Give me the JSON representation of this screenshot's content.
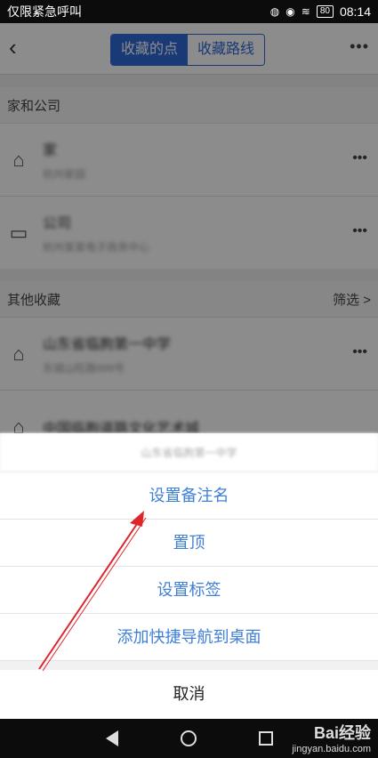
{
  "status_bar": {
    "carrier": "仅限紧急呼叫",
    "battery": "80",
    "time": "08:14"
  },
  "header": {
    "tabs": [
      {
        "label": "收藏的点",
        "active": true
      },
      {
        "label": "收藏路线",
        "active": false
      }
    ],
    "more": "•••"
  },
  "sections": {
    "home_company": {
      "title": "家和公司"
    },
    "others": {
      "title": "其他收藏",
      "filter": "筛选 >"
    }
  },
  "rows": [
    {
      "title": "家",
      "subtitle": "杭州家园"
    },
    {
      "title": "公司",
      "subtitle": "杭州某某电子商务中心"
    },
    {
      "title": "山东省临朐第一中学",
      "subtitle": "东城山旺路999号"
    },
    {
      "title": "中国临朐道路文化艺术城",
      "subtitle": ""
    }
  ],
  "action_sheet": {
    "title": "山东省临朐第一中学",
    "options": [
      "设置备注名",
      "置顶",
      "设置标签",
      "添加快捷导航到桌面"
    ],
    "cancel": "取消"
  },
  "watermark": {
    "brand": "Bai经验",
    "url": "jingyan.baidu.com"
  },
  "colors": {
    "accent": "#2f6ad8",
    "option_text": "#3f7fd6",
    "annotation_arrow": "#e0242b"
  }
}
